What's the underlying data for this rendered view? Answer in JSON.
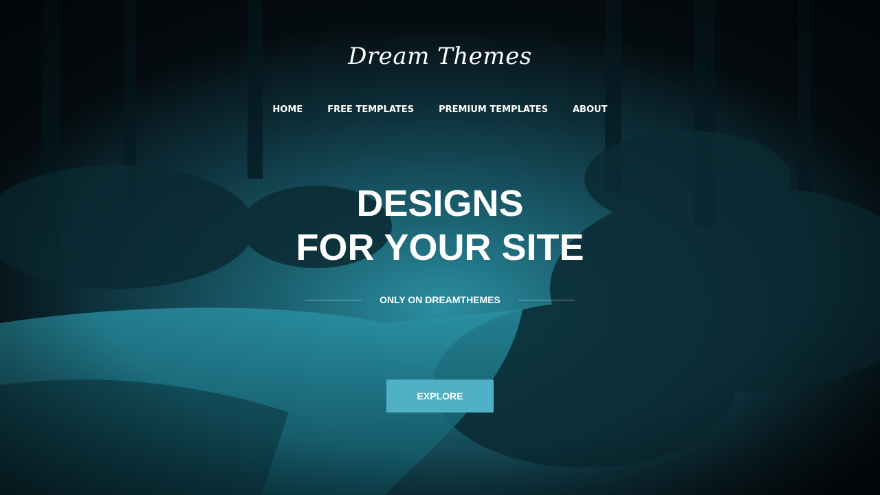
{
  "brand": {
    "logo_text": "Dream Themes"
  },
  "nav": {
    "items": [
      {
        "label": "HOME"
      },
      {
        "label": "FREE TEMPLATES"
      },
      {
        "label": "PREMIUM TEMPLATES"
      },
      {
        "label": "ABOUT"
      }
    ]
  },
  "hero": {
    "headline_line1": "DESIGNS",
    "headline_line2": "FOR YOUR SITE",
    "tagline": "ONLY ON DREAMTHEMES",
    "cta_label": "EXPLORE"
  },
  "colors": {
    "accent": "#4fb0c6",
    "background_dark": "#061116",
    "water_teal": "#2a8ea0"
  }
}
